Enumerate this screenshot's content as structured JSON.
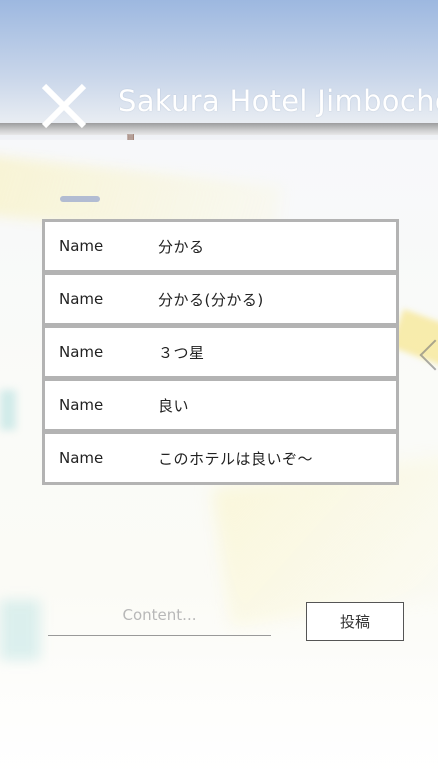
{
  "header": {
    "title": "Sakura Hotel Jimbocho",
    "close_icon": "close-icon"
  },
  "comments": [
    {
      "name": "Name",
      "text": "分かる"
    },
    {
      "name": "Name",
      "text": "分かる(分かる)"
    },
    {
      "name": "Name",
      "text": "３つ星"
    },
    {
      "name": "Name",
      "text": "良い"
    },
    {
      "name": "Name",
      "text": "このホテルは良いぞ〜"
    }
  ],
  "composer": {
    "placeholder": "Content...",
    "value": "",
    "post_label": "投稿"
  },
  "colors": {
    "list_border": "#b3b3b3",
    "title_text": "#ffffff",
    "sky_top": "#9db8e0"
  }
}
